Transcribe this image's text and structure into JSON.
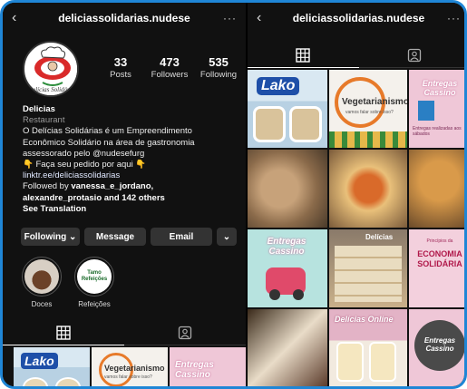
{
  "left": {
    "username": "deliciassolidarias.nudese",
    "back_icon": "back-arrow-icon",
    "more_icon": "more-dots-icon",
    "avatar_caption": "Delícias Solidárias",
    "stats": [
      {
        "num": "33",
        "label": "Posts"
      },
      {
        "num": "473",
        "label": "Followers"
      },
      {
        "num": "535",
        "label": "Following"
      }
    ],
    "bio": {
      "name": "Delicias",
      "category": "Restaurant",
      "line1": "O Delícias Solidárias é um Empreendimento",
      "line2": "Econômico Solidário na área de gastronomia",
      "line3": "assessorado pelo @nudesefurg",
      "line4": "👇 Faça seu pedido por aqui 👇",
      "line5": "linktr.ee/deliciassolidarias",
      "followed_by_prefix": "Followed by ",
      "followed_by_1": "vanessa_e_jordano,",
      "followed_by_2": "alexandre_protasio and 142 others",
      "see_translation": "See Translation"
    },
    "buttons": {
      "following": "Following ⌄",
      "message": "Message",
      "email": "Email",
      "more": "⌄"
    },
    "highlights": [
      {
        "label": "Doces"
      },
      {
        "label": "Refeições",
        "badge": "Tamo Refeições"
      }
    ],
    "posts": [
      {
        "text": "Lako"
      },
      {
        "text": "Vegetarianismo",
        "sub": "vamos falar sobre isso?"
      },
      {
        "text": "Entregas Cassino"
      }
    ]
  },
  "right": {
    "username": "deliciassolidarias.nudese",
    "back_icon": "back-arrow-icon",
    "more_icon": "more-dots-icon",
    "posts": [
      {
        "text": "Lako"
      },
      {
        "text": "Vegetarianismo",
        "sub": "vamos falar sobre isso?"
      },
      {
        "text": "Entregas Cassino",
        "sub": "Entregas realizadas aos sábados"
      },
      {
        "text": ""
      },
      {
        "text": ""
      },
      {
        "text": ""
      },
      {
        "text": ""
      },
      {
        "text": "Entregas Cassino"
      },
      {
        "text": "Delícias"
      },
      {
        "text": "Princípios da",
        "sub": "ECONOMIA SOLIDÁRIA"
      },
      {
        "text": ""
      },
      {
        "text": "Delícias Online"
      },
      {
        "text": "Entregas Cassino"
      }
    ]
  },
  "colors": {
    "frame": "#1f86d6",
    "bg": "#111111",
    "button": "#333333"
  }
}
